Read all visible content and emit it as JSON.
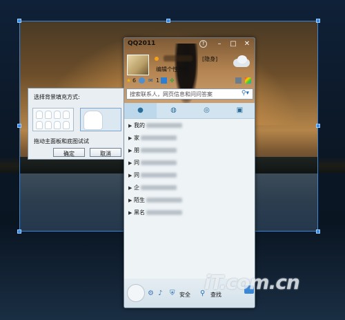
{
  "qq": {
    "title": "QQ2011",
    "status_tag": "[隐身]",
    "signature": "编辑个性签名",
    "level_count": "6",
    "mail_count": "1",
    "search_placeholder": "搜索联系人，网页信息和问问答案",
    "groups": [
      {
        "name": "我的"
      },
      {
        "name": "家"
      },
      {
        "name": "朋"
      },
      {
        "name": "同"
      },
      {
        "name": "同"
      },
      {
        "name": "企"
      },
      {
        "name": "陌生"
      },
      {
        "name": "黑名"
      }
    ],
    "bottom": {
      "safety_label": "安全",
      "find_label": "查找"
    }
  },
  "dialog": {
    "title": "选择背景填充方式:",
    "hint": "拖动主面板和底图试试",
    "ok_label": "确定",
    "cancel_label": "取消",
    "selected_mode": "stretch"
  },
  "watermark": "iT.com.cn",
  "icons": [
    "help-icon",
    "minimize-icon",
    "maximize-icon",
    "close-icon",
    "weather-icon",
    "star-icon",
    "zone-icon",
    "mail-icon",
    "app-icon",
    "clover-icon",
    "tool-icon",
    "skin-icon",
    "search-icon",
    "contacts-tab-icon",
    "group-tab-icon",
    "recent-tab-icon",
    "apps-tab-icon",
    "expand-arrow-icon",
    "qq-logo-icon",
    "settings-icon",
    "sound-icon",
    "shield-icon",
    "find-icon",
    "app-center-icon"
  ]
}
